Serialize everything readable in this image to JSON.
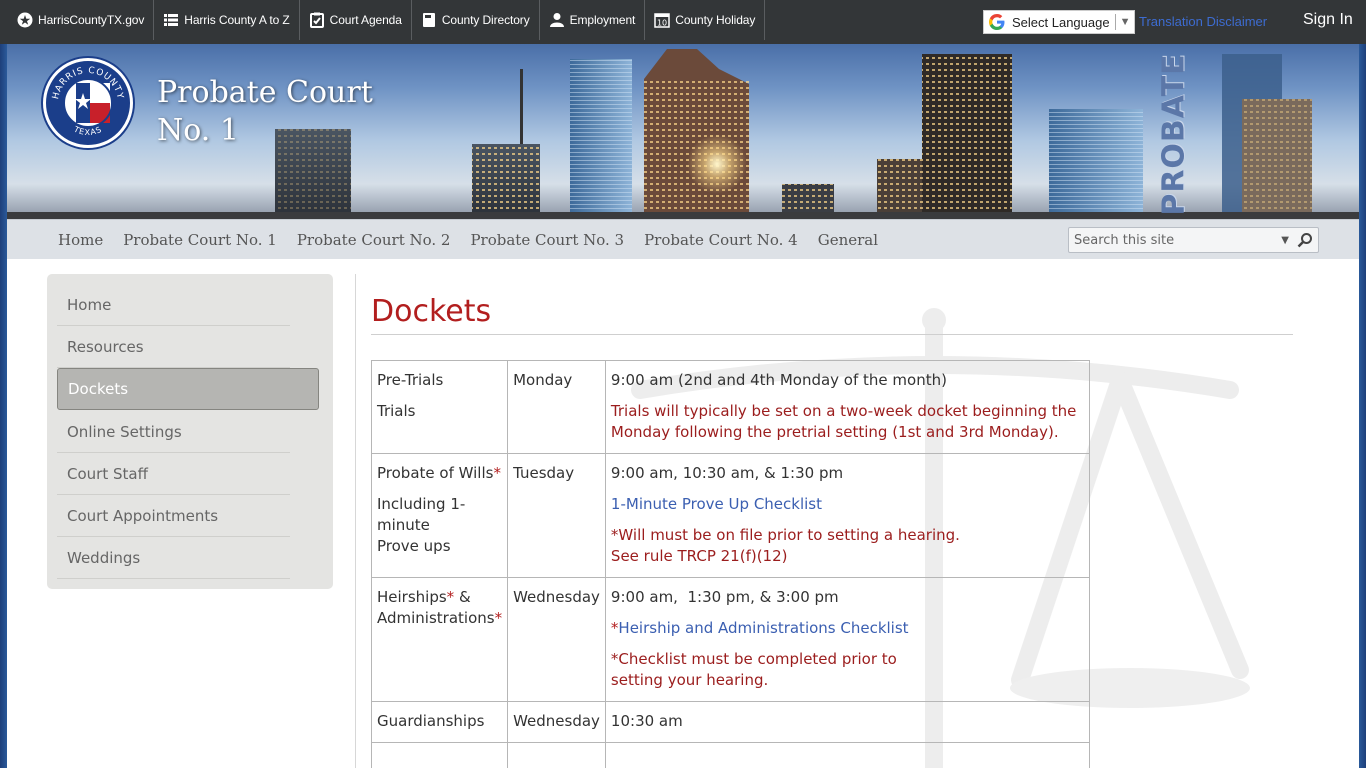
{
  "topbar": {
    "links": [
      {
        "label": "HarrisCountyTX.gov",
        "icon": "star-circle-icon"
      },
      {
        "label": "Harris County A to Z",
        "icon": "list-icon"
      },
      {
        "label": "Court Agenda",
        "icon": "clipboard-check-icon"
      },
      {
        "label": "County Directory",
        "icon": "book-icon"
      },
      {
        "label": "Employment",
        "icon": "person-icon"
      },
      {
        "label": "County Holiday",
        "icon": "calendar-icon"
      }
    ],
    "language_select": "Select Language",
    "disclaimer": "Translation Disclaimer",
    "signin": "Sign In"
  },
  "banner": {
    "title_line1": "Probate Court",
    "title_line2": "No. 1",
    "seal_top": "HARRIS COUNTY",
    "seal_bottom": "TEXAS",
    "vertical_word": "PROBATE"
  },
  "nav": {
    "items": [
      "Home",
      "Probate Court No. 1",
      "Probate Court No. 2",
      "Probate Court No. 3",
      "Probate Court No. 4",
      "General"
    ],
    "search_placeholder": "Search this site"
  },
  "leftnav": {
    "items": [
      "Home",
      "Resources",
      "Dockets",
      "Online Settings",
      "Court Staff",
      "Court Appointments",
      "Weddings"
    ],
    "active": "Dockets"
  },
  "main": {
    "title": "Dockets",
    "rows": [
      {
        "type": [
          "Pre-Trials",
          "Trials"
        ],
        "day": "Monday",
        "time": "9:00 am (2nd and 4th Monday of the month)",
        "note": "Trials will typically be set on a two-week docket beginning the Monday following the pretrial setting (1st and 3rd Monday)."
      },
      {
        "type_main": "Probate of Wills",
        "type_star": "*",
        "type_sub1": "Including 1-",
        "type_sub2": "minute",
        "type_sub3": "Prove ups",
        "day": "Tuesday",
        "time": "9:00 am, 10:30 am, & 1:30 pm",
        "link": "1-Minute Prove Up Checklist",
        "note1": "*Will must be on file prior to setting a hearing.",
        "note2": "See rule TRCP 21(f)(12)"
      },
      {
        "type_a": "Heirships",
        "type_a_star": "*",
        "type_amp": " &",
        "type_b": "Administrations",
        "type_b_star": "*",
        "day": "Wednesday",
        "time": "9:00 am,  1:30 pm, & 3:00 pm",
        "link_star": "*",
        "link": "Heirship and Administrations Checklist",
        "note1": "*Checklist must be completed prior to",
        "note2": "setting your hearing."
      },
      {
        "type": "Guardianships",
        "day": "Wednesday",
        "time": "10:30 am"
      }
    ]
  },
  "colors": {
    "topbar_bg": "#333638",
    "title_red": "#b21e1e",
    "note_red": "#9b1d1d",
    "link_blue": "#3b5fb1",
    "nav_bg": "#dde1e6",
    "sidebar_bg": "#e4e4e2",
    "sidebar_active": "#b5b5b2"
  }
}
